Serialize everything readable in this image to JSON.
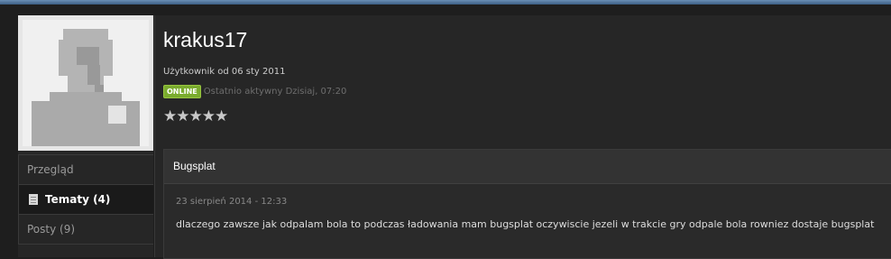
{
  "profile": {
    "username": "krakus17",
    "member_since": "Użytkownik od 06 sty 2011",
    "status_badge": "ONLINE",
    "last_active": "Ostatnio aktywny Dzisiaj, 07:20",
    "rating_stars": "★★★★★",
    "rating_value": 5,
    "rating_max": 5
  },
  "sidebar": {
    "items": [
      {
        "label": "Przegląd"
      },
      {
        "label": "Tematy (4)"
      },
      {
        "label": "Posty (9)"
      }
    ]
  },
  "post": {
    "title": "Bugsplat",
    "date": "23 sierpień 2014 - 12:33",
    "body": "dlaczego zawsze jak odpalam bola to podczas ładowania mam bugsplat oczywiscie jezeli w trakcie gry odpale bola rowniez dostaje bugsplat"
  },
  "colors": {
    "online_badge": "#7aab2e",
    "top_bar": "#4e7199"
  }
}
